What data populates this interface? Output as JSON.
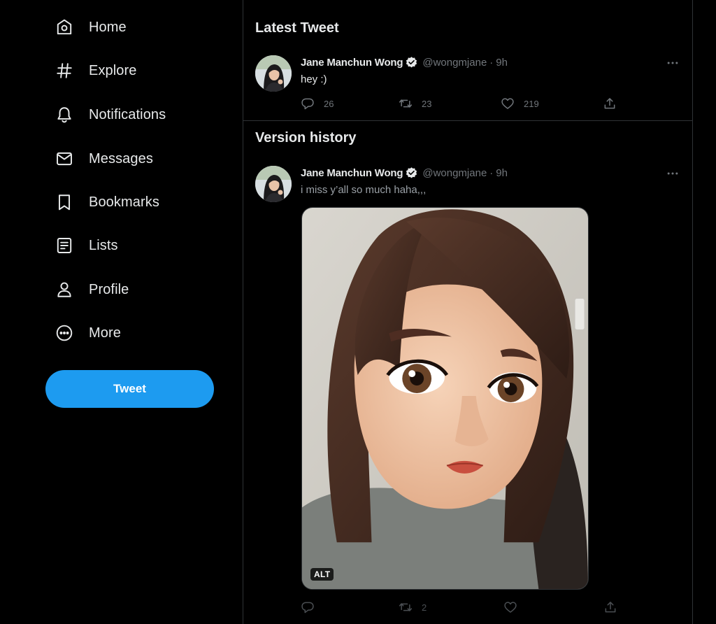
{
  "sidebar": {
    "items": [
      {
        "label": "Home",
        "icon": "home-icon"
      },
      {
        "label": "Explore",
        "icon": "hashtag-icon"
      },
      {
        "label": "Notifications",
        "icon": "bell-icon"
      },
      {
        "label": "Messages",
        "icon": "envelope-icon"
      },
      {
        "label": "Bookmarks",
        "icon": "bookmark-icon"
      },
      {
        "label": "Lists",
        "icon": "list-icon"
      },
      {
        "label": "Profile",
        "icon": "person-icon"
      },
      {
        "label": "More",
        "icon": "more-circle-icon"
      }
    ],
    "tweet_button": "Tweet"
  },
  "latest": {
    "title": "Latest Tweet",
    "tweet": {
      "name": "Jane Manchun Wong",
      "handle": "@wongmjane",
      "separator": "·",
      "time": "9h",
      "text": "hey :)",
      "replies": "26",
      "retweets": "23",
      "likes": "219"
    }
  },
  "history": {
    "title": "Version history",
    "tweet": {
      "name": "Jane Manchun Wong",
      "handle": "@wongmjane",
      "separator": "·",
      "time": "9h",
      "text": "i miss y’all so much haha,,,",
      "alt_badge": "ALT",
      "retweets": "2"
    }
  },
  "colors": {
    "accent": "#1d9bf0",
    "background": "#000000",
    "text": "#e7e9ea",
    "muted": "#71767b",
    "border": "#2f3336"
  }
}
